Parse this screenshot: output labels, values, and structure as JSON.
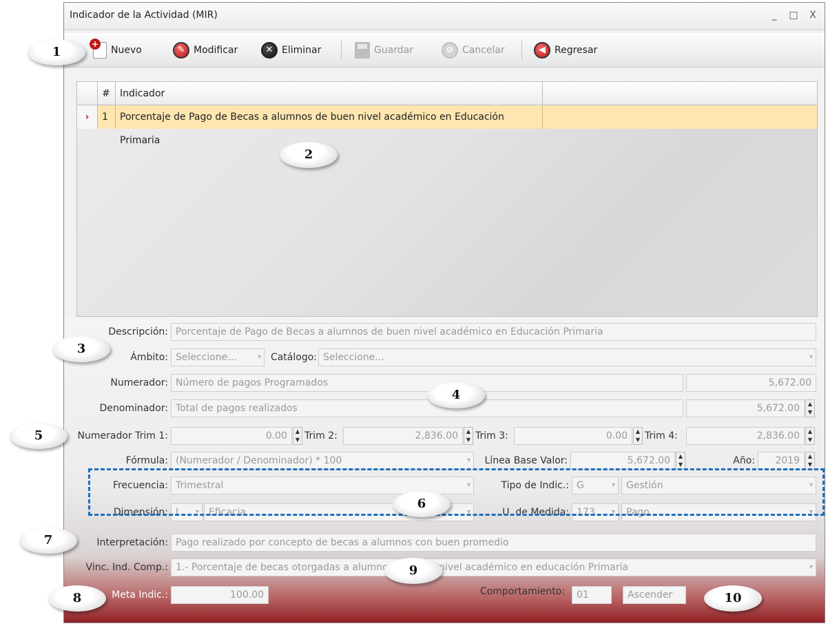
{
  "window": {
    "title": "Indicador de la Actividad (MIR)",
    "controls": [
      "_",
      "□",
      "X"
    ]
  },
  "toolbar": {
    "nuevo": "Nuevo",
    "modificar": "Modificar",
    "eliminar": "Eliminar",
    "guardar": "Guardar",
    "cancelar": "Cancelar",
    "regresar": "Regresar"
  },
  "grid": {
    "headers": {
      "num": "#",
      "indicador": "Indicador"
    },
    "rows": [
      {
        "num": "1",
        "indicador": "Porcentaje de Pago de Becas a alumnos de buen nivel académico en Educación Primaria"
      }
    ]
  },
  "form": {
    "descripcion": {
      "label": "Descripción:",
      "value": "Porcentaje de Pago de Becas a alumnos de buen nivel académico en Educación Primaria"
    },
    "ambito": {
      "label": "Ámbito:",
      "value": "Seleccione..."
    },
    "catalogo": {
      "label": "Catálogo:",
      "value": "Seleccione..."
    },
    "numerador": {
      "label": "Numerador:",
      "value": "Número de pagos Programados",
      "amount": "5,672.00"
    },
    "denominador": {
      "label": "Denominador:",
      "value": "Total de pagos realizados",
      "amount": "5,672.00"
    },
    "trim1": {
      "label": "Numerador Trim 1:",
      "value": "0.00"
    },
    "trim2": {
      "label": "Trim 2:",
      "value": "2,836.00"
    },
    "trim3": {
      "label": "Trim 3:",
      "value": "0.00"
    },
    "trim4": {
      "label": "Trim 4:",
      "value": "2,836.00"
    },
    "formula": {
      "label": "Fórmula:",
      "value": "(Numerador / Denominador) * 100"
    },
    "linea_base": {
      "label": "Línea Base Valor:",
      "value": "5,672.00"
    },
    "anio": {
      "label": "Año:",
      "value": "2019"
    },
    "frecuencia": {
      "label": "Frecuencia:",
      "value": "Trimestral"
    },
    "tipo_indic": {
      "label": "Tipo de Indic.:",
      "code": "G",
      "value": "Gestión"
    },
    "dimension": {
      "label": "Dimensión:",
      "code": "I",
      "value": "Eficacia"
    },
    "u_medida": {
      "label": "U. de Medida:",
      "code": "173",
      "value": "Pago"
    },
    "interpretacion": {
      "label": "Interpretación:",
      "value": "Pago realizado por concepto de becas a alumnos con buen promedio"
    },
    "vinc": {
      "label": "Vinc. Ind. Comp.:",
      "value": "1.- Porcentaje de becas otorgadas a alumnos de buen nivel académico en educación Primaria"
    },
    "meta": {
      "label": "Meta Indic.:",
      "value": "100.00"
    },
    "comportamiento": {
      "label": "Comportamiento:",
      "code": "01",
      "value": "Ascender"
    }
  },
  "callouts": [
    "1",
    "2",
    "3",
    "4",
    "5",
    "6",
    "7",
    "8",
    "9",
    "10"
  ]
}
